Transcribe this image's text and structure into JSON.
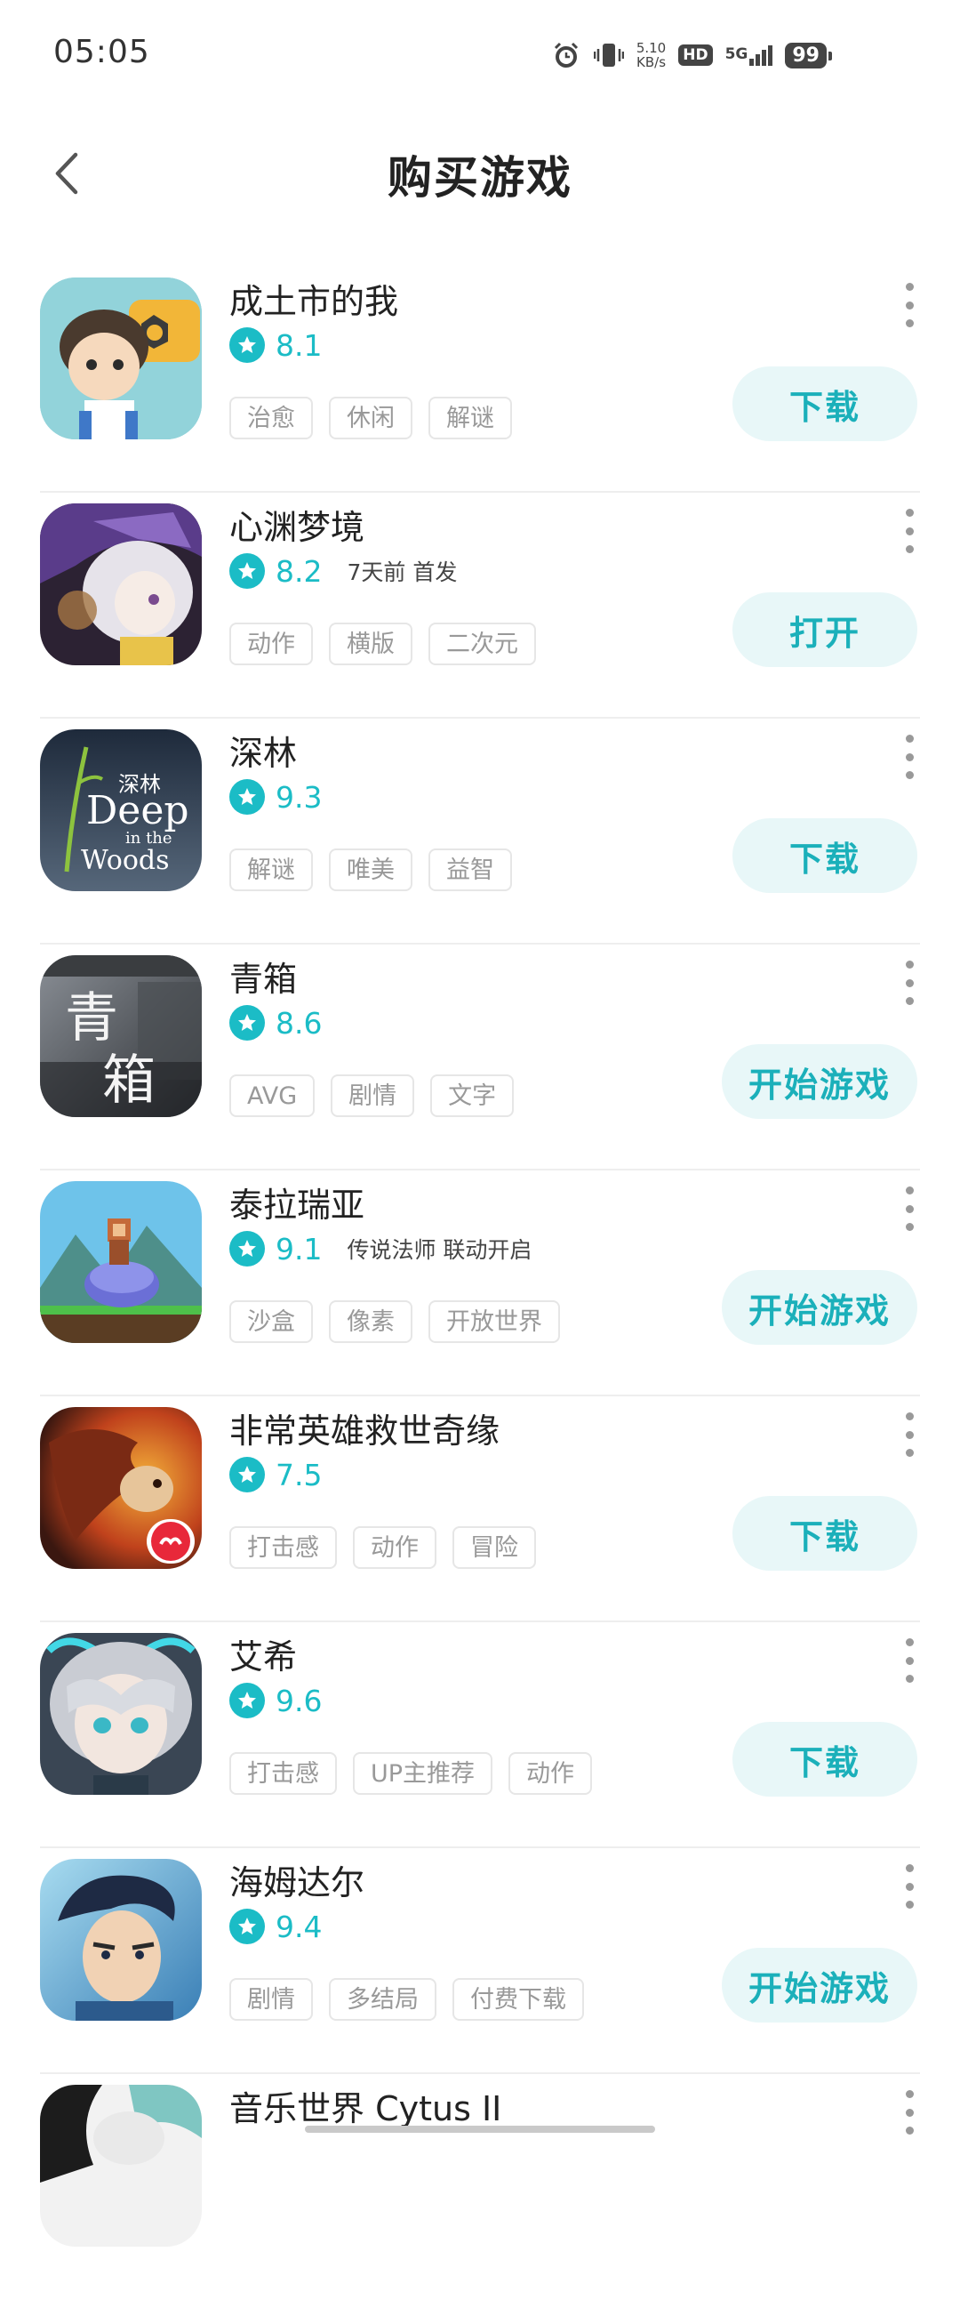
{
  "status_bar": {
    "time": "05:05",
    "net_speed_value": "5.10",
    "net_speed_unit": "KB/s",
    "hd": "HD",
    "network": "5G",
    "battery": "99"
  },
  "header": {
    "title": "购买游戏"
  },
  "colors": {
    "accent": "#1bbcc6",
    "button_bg": "#e8f7f8",
    "button_text": "#1bb0ba"
  },
  "games": [
    {
      "name": "成土市的我",
      "rating": "8.1",
      "note": "",
      "tags": [
        "治愈",
        "休闲",
        "解谜"
      ],
      "action": "下载",
      "icon": "game-icon-chengtushi"
    },
    {
      "name": "心渊梦境",
      "rating": "8.2",
      "note": "7天前 首发",
      "tags": [
        "动作",
        "横版",
        "二次元"
      ],
      "action": "打开",
      "icon": "game-icon-xinyuanmengjing"
    },
    {
      "name": "深林",
      "rating": "9.3",
      "note": "",
      "tags": [
        "解谜",
        "唯美",
        "益智"
      ],
      "action": "下载",
      "icon": "game-icon-shenlin",
      "icon_text": [
        "深林",
        "Deep",
        "in the",
        "Woods"
      ]
    },
    {
      "name": "青箱",
      "rating": "8.6",
      "note": "",
      "tags": [
        "AVG",
        "剧情",
        "文字"
      ],
      "action": "开始游戏",
      "icon": "game-icon-qingxiang",
      "icon_text": [
        "青",
        "箱"
      ]
    },
    {
      "name": "泰拉瑞亚",
      "rating": "9.1",
      "note": "传说法师 联动开启",
      "tags": [
        "沙盒",
        "像素",
        "开放世界"
      ],
      "action": "开始游戏",
      "icon": "game-icon-terraria"
    },
    {
      "name": "非常英雄救世奇缘",
      "rating": "7.5",
      "note": "",
      "tags": [
        "打击感",
        "动作",
        "冒险"
      ],
      "action": "下载",
      "icon": "game-icon-feichangyingxiong"
    },
    {
      "name": "艾希",
      "rating": "9.6",
      "note": "",
      "tags": [
        "打击感",
        "UP主推荐",
        "动作"
      ],
      "action": "下载",
      "icon": "game-icon-aixi"
    },
    {
      "name": "海姆达尔",
      "rating": "9.4",
      "note": "",
      "tags": [
        "剧情",
        "多结局",
        "付费下载"
      ],
      "action": "开始游戏",
      "icon": "game-icon-haimudaer"
    },
    {
      "name": "音乐世界 Cytus II",
      "rating": "",
      "note": "",
      "tags": [],
      "action": "",
      "icon": "game-icon-cytus"
    }
  ]
}
